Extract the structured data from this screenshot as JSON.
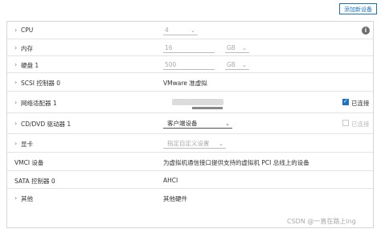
{
  "toolbar": {
    "add_device_label": "添加新设备"
  },
  "rows": {
    "cpu": {
      "label": "CPU",
      "value": "4"
    },
    "memory": {
      "label": "内存",
      "value": "16",
      "unit": "GB"
    },
    "disk": {
      "label": "硬盘 1",
      "value": "500",
      "unit": "GB"
    },
    "scsi": {
      "label": "SCSI 控制器 0",
      "value": "VMware 准虚拟"
    },
    "nic": {
      "label": "网络适配器 1",
      "connected_label": "已连接",
      "connected": true
    },
    "cddvd": {
      "label": "CD/DVD 驱动器 1",
      "value": "客户端设备",
      "connected_label": "已连接",
      "connected": false
    },
    "video": {
      "label": "显卡",
      "value": "指定自定义设置"
    },
    "vmci": {
      "label": "VMCI 设备",
      "value": "为虚拟机通信接口提供支持的虚拟机 PCI 总线上的设备"
    },
    "sata": {
      "label": "SATA 控制器 0",
      "value": "AHCI"
    },
    "other": {
      "label": "其他",
      "value": "其他硬件"
    }
  },
  "icons": {
    "expand": "chevron-right-icon",
    "info": "info-icon",
    "dropdown": "chevron-down-icon"
  },
  "watermark": "CSDN @一直在路上ing"
}
